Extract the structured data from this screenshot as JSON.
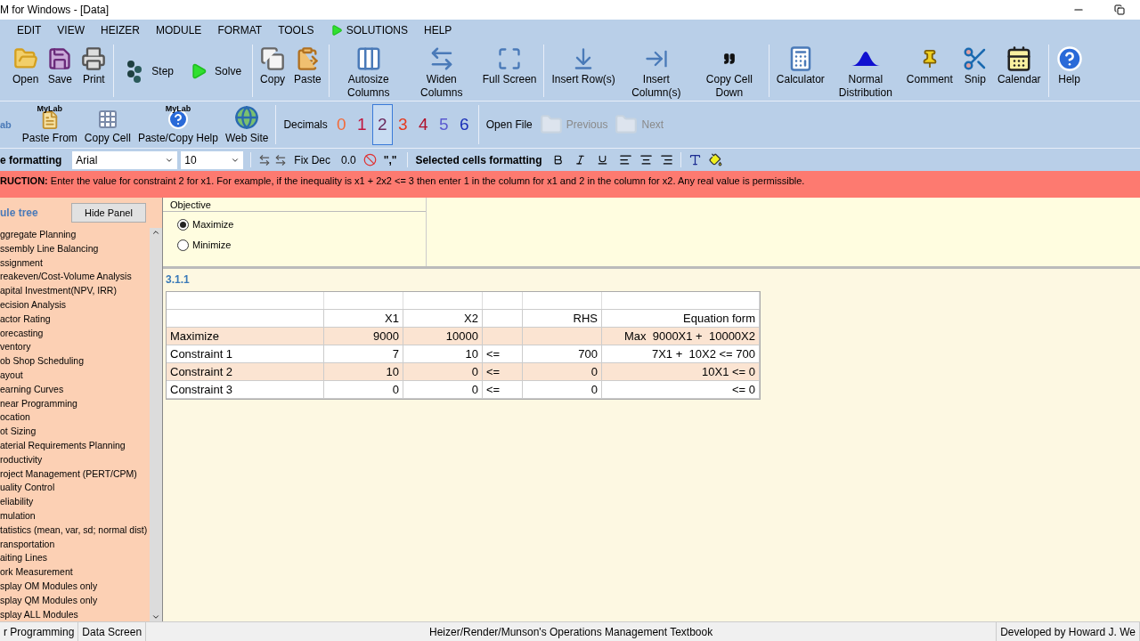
{
  "window": {
    "title": "M for Windows - [Data]"
  },
  "menu": [
    {
      "label": "EDIT",
      "kind": "plain"
    },
    {
      "label": "VIEW",
      "kind": "plain"
    },
    {
      "label": "HEIZER",
      "kind": "plain"
    },
    {
      "label": "MODULE",
      "kind": "plain"
    },
    {
      "label": "FORMAT",
      "kind": "plain"
    },
    {
      "label": "TOOLS",
      "kind": "plain"
    },
    {
      "label": "SOLUTIONS",
      "kind": "play"
    },
    {
      "label": "HELP",
      "kind": "plain"
    }
  ],
  "toolbar": [
    [
      {
        "label": "Open",
        "kind": "stacked"
      },
      {
        "label": "Save",
        "kind": "stacked"
      },
      {
        "label": "Print",
        "kind": "stacked"
      }
    ],
    [
      {
        "label": "Step",
        "kind": "inline"
      },
      {
        "label": "Solve",
        "kind": "inline"
      }
    ],
    [
      {
        "label": "Copy",
        "kind": "stacked"
      },
      {
        "label": "Paste",
        "kind": "stacked"
      }
    ],
    [
      {
        "label": "Autosize Columns",
        "kind": "stacked"
      },
      {
        "label": "Widen Columns",
        "kind": "stacked"
      },
      {
        "label": "Full Screen",
        "kind": "stacked"
      }
    ],
    [
      {
        "label": "Insert Row(s)",
        "kind": "stacked"
      },
      {
        "label": "Insert Column(s)",
        "kind": "stacked"
      },
      {
        "label": "Copy Cell Down",
        "kind": "stacked"
      }
    ],
    [
      {
        "label": "Calculator",
        "kind": "stacked"
      },
      {
        "label": "Normal Distribution",
        "kind": "stacked"
      },
      {
        "label": "Comment",
        "kind": "stacked"
      },
      {
        "label": "Snip",
        "kind": "stacked"
      },
      {
        "label": "Calendar",
        "kind": "stacked"
      }
    ],
    [
      {
        "label": "Help",
        "kind": "stacked"
      }
    ]
  ],
  "toolbar2": {
    "cut_label": "ab",
    "buttons": [
      {
        "label": "Paste From",
        "badge": "MyLab"
      },
      {
        "label": "Copy Cell"
      },
      {
        "label": "Paste/Copy Help",
        "badge": "MyLab"
      },
      {
        "label": "Web Site"
      }
    ],
    "decimals_label": "Decimals",
    "decimals": [
      {
        "label": "0",
        "color": "#f26b3a",
        "selected": false
      },
      {
        "label": "1",
        "color": "#c0143c",
        "selected": false
      },
      {
        "label": "2",
        "color": "#6b2b5e",
        "selected": true
      },
      {
        "label": "3",
        "color": "#e63a1e",
        "selected": false
      },
      {
        "label": "4",
        "color": "#b0102a",
        "selected": false
      },
      {
        "label": "5",
        "color": "#5a5ad0",
        "selected": false
      },
      {
        "label": "6",
        "color": "#1a2fb8",
        "selected": false
      }
    ],
    "open_file": "Open File",
    "nav": [
      {
        "label": "Previous",
        "disabled": true
      },
      {
        "label": "Next",
        "disabled": true
      }
    ]
  },
  "format_bar": {
    "label": "e formatting",
    "font": "Arial",
    "size": "10",
    "fix_dec": "Fix Dec",
    "zero_format": "0.0",
    "comma": "\",\"",
    "selected_label": "Selected cells formatting"
  },
  "instruction": {
    "label": "RUCTION:",
    "text": "Enter the value for constraint 2 for x1. For example, if the inequality is x1 + 2x2 <= 3 then enter 1 in the column for x1 and 2 in the column for x2. Any real value is permissible."
  },
  "sidebar": {
    "title": "ule tree",
    "hide_button": "Hide Panel",
    "items": [
      "ggregate Planning",
      "ssembly Line Balancing",
      "ssignment",
      "reakeven/Cost-Volume Analysis",
      "apital Investment(NPV, IRR)",
      "ecision Analysis",
      "actor Rating",
      "orecasting",
      "ventory",
      "ob Shop Scheduling",
      "ayout",
      "earning Curves",
      "near Programming",
      "ocation",
      "ot Sizing",
      "aterial Requirements Planning",
      "roductivity",
      "roject Management (PERT/CPM)",
      "uality Control",
      "eliability",
      "mulation",
      "tatistics (mean, var, sd; normal dist)",
      "ransportation",
      "aiting Lines",
      "ork Measurement",
      "splay OM Modules only",
      "splay QM Modules only",
      "splay ALL Modules"
    ]
  },
  "objective": {
    "title": "Objective",
    "options": [
      {
        "label": "Maximize",
        "selected": true
      },
      {
        "label": "Minimize",
        "selected": false
      }
    ]
  },
  "table": {
    "title": "3.1.1",
    "columns": [
      "",
      "X1",
      "X2",
      "",
      "RHS",
      "Equation form"
    ],
    "rows": [
      [
        "Maximize",
        "9000",
        "10000",
        "",
        "",
        "Max  9000X1 +  10000X2"
      ],
      [
        "Constraint 1",
        "7",
        "10",
        "<=",
        "700",
        "7X1 +  10X2 <= 700"
      ],
      [
        "Constraint 2",
        "10",
        "0",
        "<=",
        "0",
        "10X1 <= 0"
      ],
      [
        "Constraint 3",
        "0",
        "0",
        "<=",
        "0",
        "<= 0"
      ]
    ]
  },
  "status_bar": [
    "r Programming",
    "Data Screen",
    "Heizer/Render/Munson's Operations Management Textbook",
    "Developed by Howard J. We"
  ]
}
